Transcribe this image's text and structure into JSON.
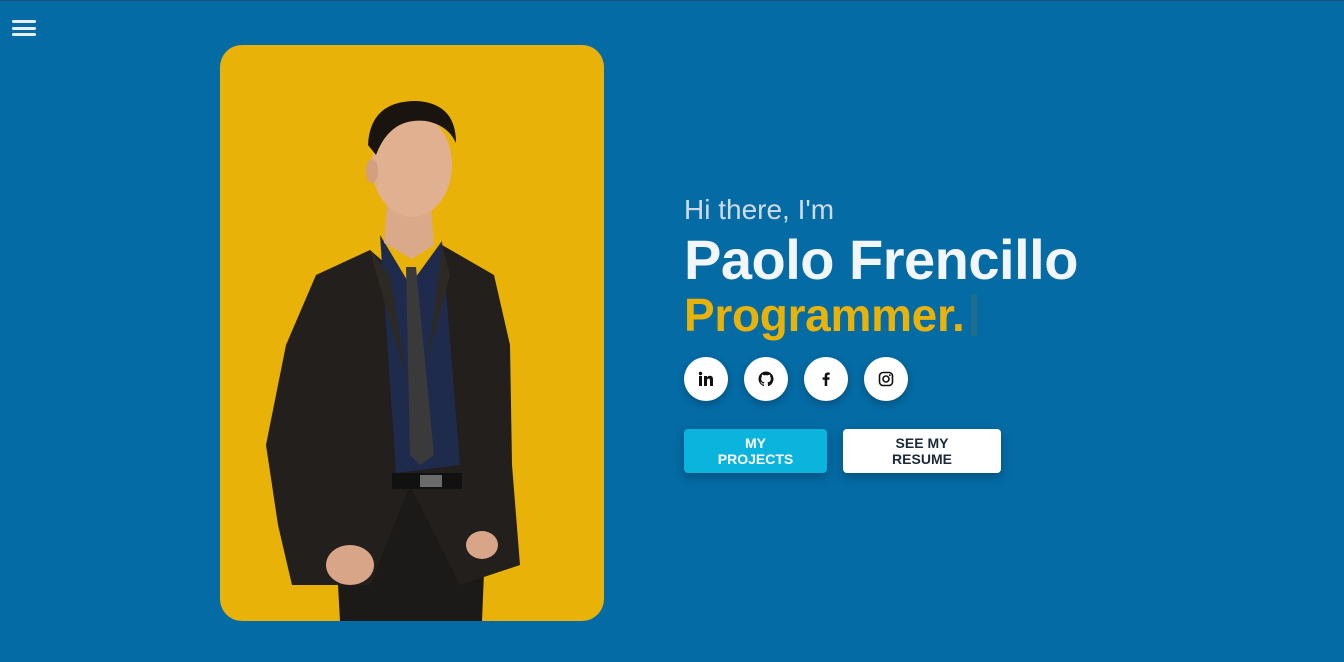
{
  "nav": {
    "menu_icon": "hamburger-menu-icon"
  },
  "hero": {
    "greeting": "Hi there, I'm",
    "name": "Paolo Frencillo",
    "role": "Programmer."
  },
  "socials": [
    {
      "name": "linkedin",
      "icon": "linkedin-icon"
    },
    {
      "name": "github",
      "icon": "github-icon"
    },
    {
      "name": "facebook",
      "icon": "facebook-icon"
    },
    {
      "name": "instagram",
      "icon": "instagram-icon"
    }
  ],
  "actions": {
    "projects_label": "MY PROJECTS",
    "resume_label": "SEE MY RESUME"
  },
  "colors": {
    "background": "#046ba5",
    "accent": "#e9b208",
    "primary_button": "#0bb4dc"
  }
}
